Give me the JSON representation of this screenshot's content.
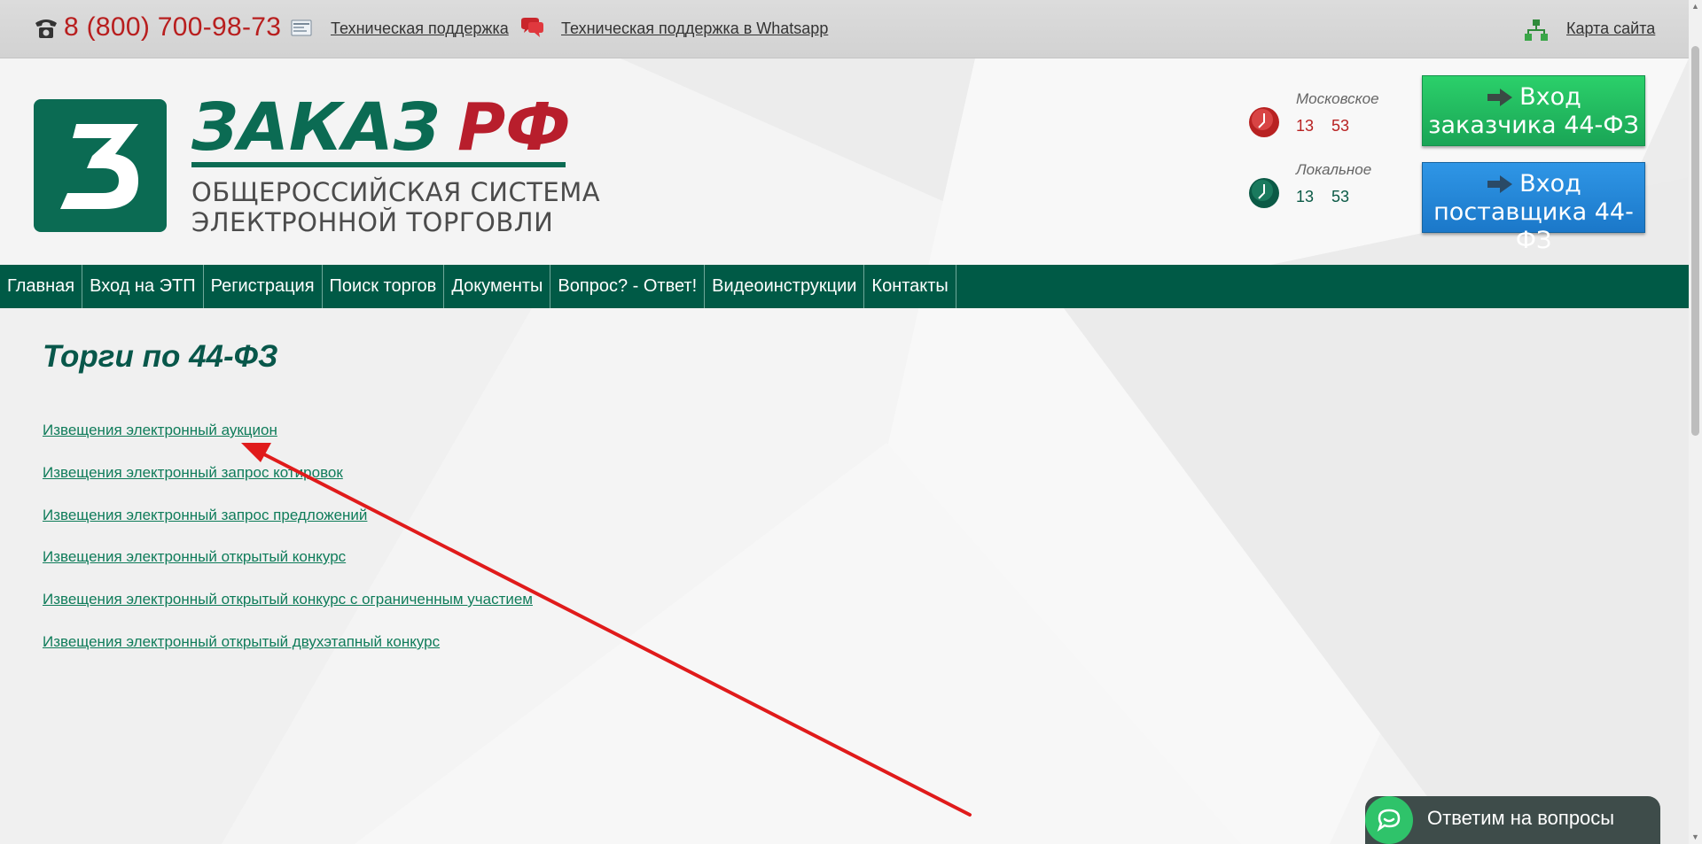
{
  "topbar": {
    "phone": "8 (800) 700-98-73",
    "support_link": "Техническая поддержка",
    "whatsapp_link": "Техническая поддержка в Whatsapp",
    "sitemap_link": "Карта сайта"
  },
  "header": {
    "logo_mark_letter": "З",
    "logo_word_green": "ЗАКАЗ",
    "logo_word_red": "РФ",
    "logo_subtitle_1": "ОБЩЕРОССИЙСКАЯ СИСТЕМА",
    "logo_subtitle_2": "ЭЛЕКТРОННОЙ ТОРГОВЛИ",
    "clocks": [
      {
        "label": "Московское",
        "hours": "13",
        "minutes": "53",
        "color": "#b82222"
      },
      {
        "label": "Локальное",
        "hours": "13",
        "minutes": "53",
        "color": "#0b6b53"
      }
    ],
    "login_customer": {
      "line1": "Вход",
      "line2": "заказчика 44-ФЗ"
    },
    "login_supplier": {
      "line1": "Вход",
      "line2": "поставщика 44-ФЗ"
    }
  },
  "nav": [
    "Главная",
    "Вход на ЭТП",
    "Регистрация",
    "Поиск торгов",
    "Документы",
    "Вопрос? - Ответ!",
    "Видеоинструкции",
    "Контакты"
  ],
  "main": {
    "title": "Торги по 44-ФЗ",
    "links": [
      "Извещения электронный аукцион",
      "Извещения электронный запрос котировок",
      "Извещения электронный запрос предложений",
      "Извещения электронный открытый конкурс",
      "Извещения электронный открытый конкурс с ограниченным участием",
      "Извещения электронный открытый двухэтапный конкурс"
    ]
  },
  "chat": {
    "label": "Ответим на вопросы"
  },
  "colors": {
    "brand_green": "#005a46",
    "brand_red": "#b81e1e",
    "link": "#0f7c5a",
    "annotation": "#e01b1b"
  },
  "icons": [
    "phone-icon",
    "support-icon",
    "whatsapp-icon",
    "sitemap-icon",
    "clock-icon",
    "arrow-right-icon",
    "chat-icon"
  ]
}
